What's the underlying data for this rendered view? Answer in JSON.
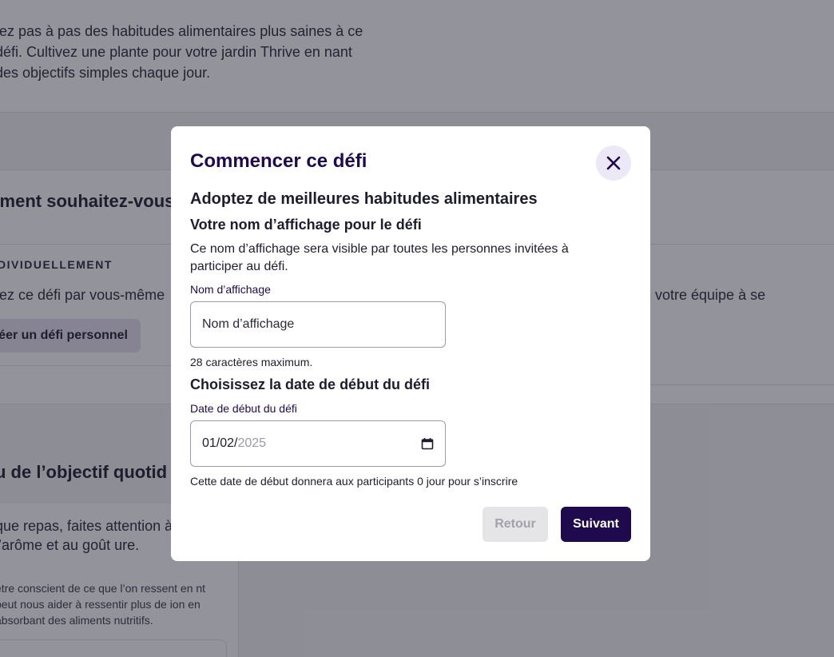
{
  "background": {
    "intro_text": "tez pas à pas des habitudes alimentaires plus saines à ce défi. Cultivez une plante pour votre jardin Thrive en nant des objectifs simples chaque jour.",
    "participation_title": "mment souhaitez-vous",
    "individual_label": "INDIVIDUELLEMENT",
    "individual_text": "evez ce défi par vous-même",
    "individual_button": "réer un défi personnel",
    "team_text": "z votre équipe à se",
    "goal_title": "u de l’objectif quotid",
    "goal_text": "que repas, faites attention à rence, à l’arôme et au goût ure.",
    "goal_subtext": "être conscient de ce que l’on ressent en nt peut nous aider à ressentir plus de ion en absorbant des aliments nutritifs."
  },
  "modal": {
    "title": "Commencer ce défi",
    "close_icon": "close-icon",
    "challenge_name": "Adoptez de meilleures habitudes alimentaires",
    "display_name": {
      "heading": "Votre nom d’affichage pour le défi",
      "description": "Ce nom d’affichage sera visible par toutes les personnes invitées à participer au défi.",
      "label": "Nom d’affichage",
      "placeholder": "Nom d’affichage",
      "value": "",
      "max_hint": "28 caractères maximum."
    },
    "start_date": {
      "heading": "Choisissez la date de début du défi",
      "label": "Date de début du défi",
      "value_day_month": "01/02/",
      "value_year": "2025",
      "calendar_icon": "calendar-icon",
      "helper": "Cette date de début donnera aux participants 0 jour pour s’inscrire"
    },
    "buttons": {
      "back": "Retour",
      "next": "Suivant"
    }
  },
  "colors": {
    "primary": "#1f0a4d",
    "close_bg": "#ece8f6",
    "disabled_bg": "#e5e5e8",
    "disabled_text": "#a2a2ad",
    "overlay": "rgba(30,30,45,0.48)"
  }
}
